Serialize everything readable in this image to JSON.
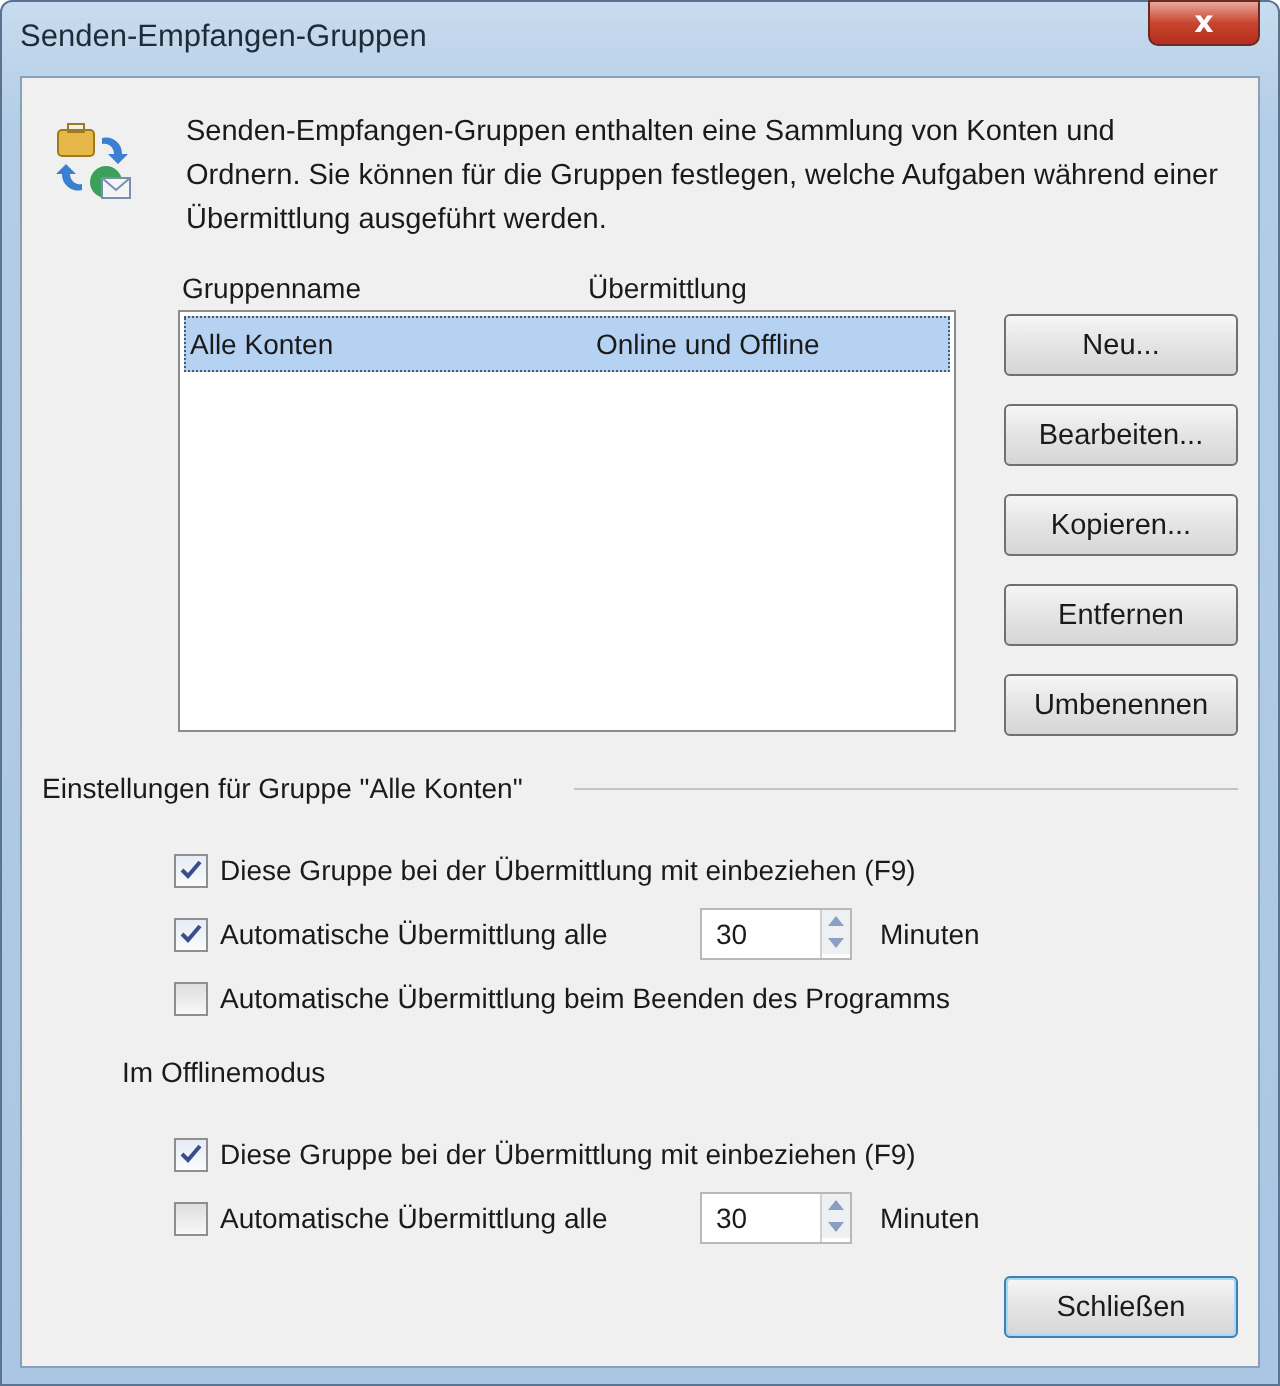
{
  "window": {
    "title": "Senden-Empfangen-Gruppen",
    "close_label": "x"
  },
  "description": "Senden-Empfangen-Gruppen enthalten eine Sammlung von Konten und Ordnern. Sie können für die Gruppen festlegen, welche Aufgaben während einer Übermittlung ausgeführt werden.",
  "table": {
    "columns": [
      "Gruppenname",
      "Übermittlung"
    ],
    "rows": [
      {
        "cells": [
          "Alle Konten",
          "Online und Offline"
        ],
        "selected": true
      }
    ]
  },
  "side_buttons": [
    "Neu...",
    "Bearbeiten...",
    "Kopieren...",
    "Entfernen",
    "Umbenennen"
  ],
  "settings_heading": "Einstellungen für Gruppe \"Alle Konten\"",
  "online_options": [
    {
      "kind": "checkbox",
      "label": "Diese Gruppe bei der Übermittlung mit einbeziehen (F9)",
      "checked": true
    },
    {
      "kind": "interval",
      "label": "Automatische Übermittlung alle",
      "checked": true,
      "value": "30",
      "unit": "Minuten"
    },
    {
      "kind": "checkbox",
      "label": "Automatische Übermittlung beim Beenden des Programms",
      "checked": false
    }
  ],
  "offline_heading": "Im Offlinemodus",
  "offline_options": [
    {
      "kind": "checkbox",
      "label": "Diese Gruppe bei der Übermittlung mit einbeziehen (F9)",
      "checked": true
    },
    {
      "kind": "interval",
      "label": "Automatische Übermittlung alle",
      "checked": false,
      "value": "30",
      "unit": "Minuten"
    }
  ],
  "close_button": "Schließen"
}
